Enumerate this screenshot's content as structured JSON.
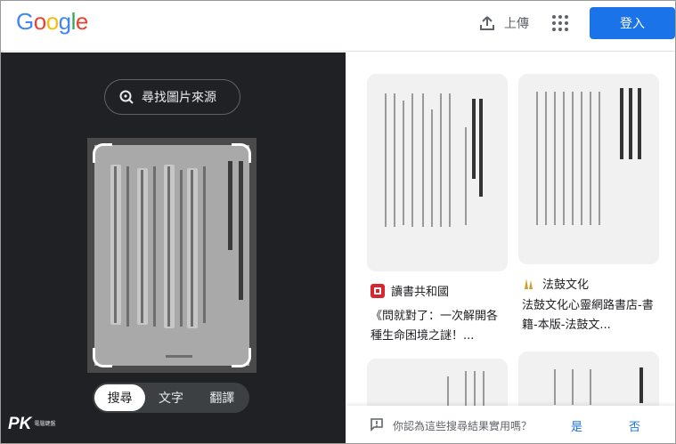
{
  "header": {
    "logo_letters": [
      {
        "ch": "G",
        "color": "#4285F4"
      },
      {
        "ch": "o",
        "color": "#EA4335"
      },
      {
        "ch": "o",
        "color": "#FBBC05"
      },
      {
        "ch": "g",
        "color": "#4285F4"
      },
      {
        "ch": "l",
        "color": "#34A853"
      },
      {
        "ch": "e",
        "color": "#EA4335"
      }
    ],
    "upload_label": "上傳",
    "login_label": "登入"
  },
  "left_panel": {
    "find_source_label": "尋找圖片來源",
    "modes": [
      {
        "label": "搜尋",
        "active": true
      },
      {
        "label": "文字",
        "active": false
      },
      {
        "label": "翻譯",
        "active": false
      }
    ],
    "watermark": {
      "logo": "PK",
      "sub": "電腦鍵盤"
    }
  },
  "results": [
    {
      "source": "讀書共和國",
      "icon": "book-red-icon",
      "description": "《問就對了：一次解開各種生命困境之謎！..."
    },
    {
      "source": "法鼓文化",
      "icon": "fagu-gold-icon",
      "description": "法鼓文化心靈網路書店-書籍-本版-法鼓文..."
    }
  ],
  "feedback": {
    "question": "你認為這些搜尋結果實用嗎？",
    "yes": "是",
    "no": "否"
  },
  "colors": {
    "accent": "#1a73e8",
    "dark_panel": "#202124"
  }
}
